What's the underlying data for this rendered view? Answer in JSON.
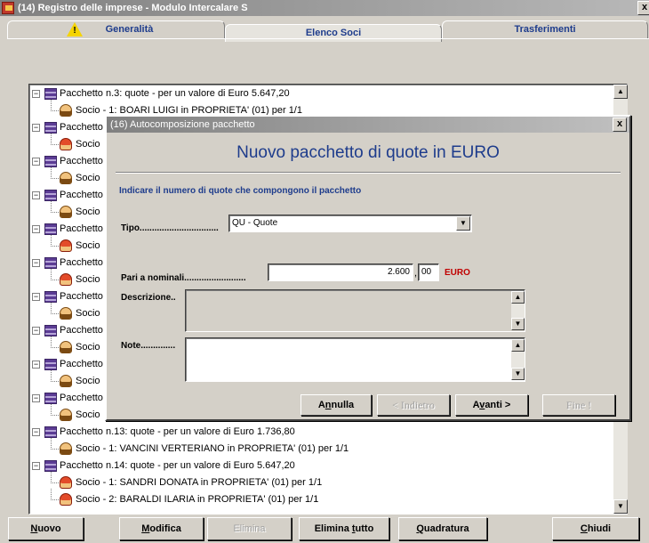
{
  "window": {
    "title": "(14) Registro delle imprese - Modulo Intercalare S",
    "close_label": "x"
  },
  "tabs": [
    {
      "label": "Generalità",
      "icon": "warning-icon"
    },
    {
      "label": "Elenco Soci"
    },
    {
      "label": "Trasferimenti"
    }
  ],
  "tree": {
    "rows": [
      {
        "kind": "pacchetto",
        "text": "Pacchetto n.3: quote - per un valore di Euro 5.647,20"
      },
      {
        "kind": "socio",
        "sex": "m",
        "text": "Socio - 1: BOARI LUIGI in PROPRIETA' (01) per 1/1"
      },
      {
        "kind": "pacchetto",
        "text": "Pacchetto"
      },
      {
        "kind": "socio",
        "sex": "f",
        "text": "Socio"
      },
      {
        "kind": "pacchetto",
        "text": "Pacchetto"
      },
      {
        "kind": "socio",
        "sex": "m",
        "text": "Socio"
      },
      {
        "kind": "pacchetto",
        "text": "Pacchetto"
      },
      {
        "kind": "socio",
        "sex": "m",
        "text": "Socio"
      },
      {
        "kind": "pacchetto",
        "text": "Pacchetto"
      },
      {
        "kind": "socio",
        "sex": "f",
        "text": "Socio"
      },
      {
        "kind": "pacchetto",
        "text": "Pacchetto"
      },
      {
        "kind": "socio",
        "sex": "f",
        "text": "Socio"
      },
      {
        "kind": "pacchetto",
        "text": "Pacchetto"
      },
      {
        "kind": "socio",
        "sex": "m",
        "text": "Socio"
      },
      {
        "kind": "pacchetto",
        "text": "Pacchetto"
      },
      {
        "kind": "socio",
        "sex": "m",
        "text": "Socio"
      },
      {
        "kind": "pacchetto",
        "text": "Pacchetto"
      },
      {
        "kind": "socio",
        "sex": "m",
        "text": "Socio"
      },
      {
        "kind": "pacchetto",
        "text": "Pacchetto"
      },
      {
        "kind": "socio",
        "sex": "m",
        "text": "Socio"
      },
      {
        "kind": "pacchetto",
        "text": "Pacchetto n.13: quote - per un valore di Euro 1.736,80"
      },
      {
        "kind": "socio",
        "sex": "m",
        "text": "Socio - 1: VANCINI VERTERIANO in PROPRIETA' (01) per 1/1"
      },
      {
        "kind": "pacchetto",
        "text": "Pacchetto n.14: quote - per un valore di Euro 5.647,20"
      },
      {
        "kind": "socio",
        "sex": "f",
        "text": "Socio - 1: SANDRI DONATA in PROPRIETA' (01) per 1/1"
      },
      {
        "kind": "socio",
        "sex": "f",
        "text": "Socio - 2: BARALDI ILARIA in PROPRIETA' (01) per 1/1"
      }
    ]
  },
  "dialog": {
    "title": "(16) Autocomposizione pacchetto",
    "close_label": "x",
    "heading": "Nuovo pacchetto di quote in EURO",
    "instruction": "Indicare il numero di quote che compongono il pacchetto",
    "tipo_label": "Tipo................................",
    "tipo_value": "QU - Quote",
    "pari_label": "Pari a  nominali.........................",
    "pari_int": "2.600",
    "pari_sep": ",",
    "pari_dec": "00",
    "currency": "EURO",
    "descrizione_label": "Descrizione..",
    "note_label": "Note..............",
    "buttons": {
      "annulla_pre": "A",
      "annulla_ul": "n",
      "annulla_post": "nulla",
      "indietro": "< Indietro",
      "avanti_pre": "A",
      "avanti_ul": "v",
      "avanti_post": "anti  >",
      "fine": "Fine !"
    }
  },
  "toolbar": {
    "nuovo_ul": "N",
    "nuovo_post": "uovo",
    "modifica_ul": "M",
    "modifica_post": "odifica",
    "elimina": "Elimina",
    "elimina_tutto_pre": "Elimina ",
    "elimina_tutto_ul": "t",
    "elimina_tutto_post": "utto",
    "quadratura_ul": "Q",
    "quadratura_post": "uadratura",
    "chiudi_ul": "C",
    "chiudi_post": "hiudi"
  },
  "colors": {
    "accent": "#1e3c8c",
    "currency": "#c00000"
  }
}
